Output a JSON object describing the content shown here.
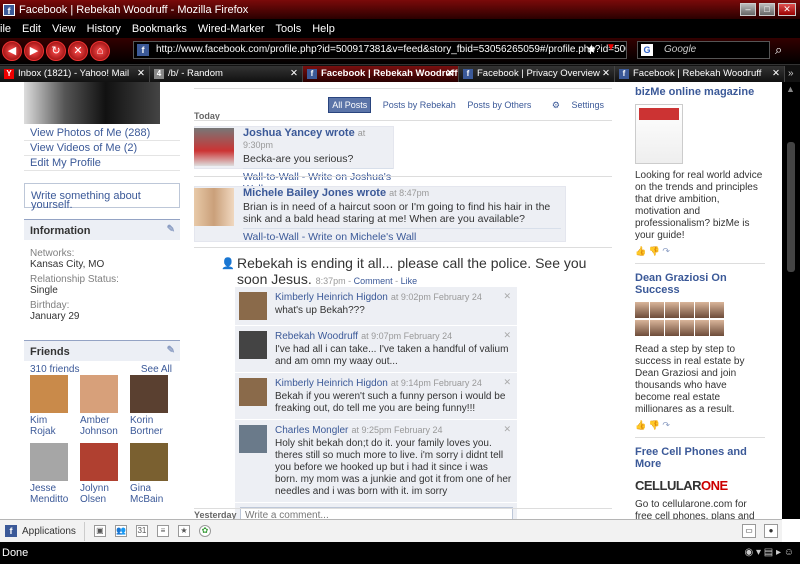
{
  "window": {
    "title": "Facebook | Rebekah Woodruff - Mozilla Firefox",
    "favicon": "f"
  },
  "menu": [
    "ile",
    "Edit",
    "View",
    "History",
    "Bookmarks",
    "Wired-Marker",
    "Tools",
    "Help"
  ],
  "nav": {
    "url": "http://www.facebook.com/profile.php?id=500917381&v=feed&story_fbid=53056265059#/profile.php?id=500917381",
    "search_placeholder": "Google",
    "search_engine": "G"
  },
  "tabs": [
    {
      "label": "Inbox (1821) - Yahoo! Mail",
      "icon": "y"
    },
    {
      "label": "/b/ - Random",
      "icon": "b"
    },
    {
      "label": "Facebook | Rebekah Woodruff",
      "icon": "f"
    },
    {
      "label": "Facebook | Privacy Overview",
      "icon": "f"
    },
    {
      "label": "Facebook | Rebekah Woodruff",
      "icon": "f"
    }
  ],
  "left": {
    "links": [
      "View Photos of Me (288)",
      "View Videos of Me (2)",
      "Edit My Profile"
    ],
    "write": "Write something about yourself.",
    "info_title": "Information",
    "info": [
      {
        "k": "Networks:",
        "v": "Kansas City, MO"
      },
      {
        "k": "Relationship Status:",
        "v": "Single"
      },
      {
        "k": "Birthday:",
        "v": "January 29"
      }
    ],
    "friends_title": "Friends",
    "friends_count": "310 friends",
    "see_all": "See All",
    "friends": [
      {
        "first": "Kim",
        "last": "Rojak",
        "color": "#c98a4a"
      },
      {
        "first": "Amber",
        "last": "Johnson",
        "color": "#d7a07a"
      },
      {
        "first": "Korin",
        "last": "Bortner",
        "color": "#5a4030"
      },
      {
        "first": "Jesse",
        "last": "Menditto",
        "color": "#a6a6a6"
      },
      {
        "first": "Jolynn",
        "last": "Olsen",
        "color": "#b04030"
      },
      {
        "first": "Gina",
        "last": "McBain",
        "color": "#7a6030"
      }
    ]
  },
  "feed": {
    "filters": {
      "all": "All Posts",
      "by_owner": "Posts by Rebekah",
      "by_others": "Posts by Others",
      "settings": "Settings"
    },
    "today": "Today",
    "yesterday": "Yesterday",
    "posts": [
      {
        "name": "Joshua Yancey",
        "verb": "wrote",
        "time": "at 9:30pm",
        "text": "Becka-are you serious?",
        "link": "Wall-to-Wall - Write on Joshua's Wall"
      },
      {
        "name": "Michele Bailey Jones",
        "verb": "wrote",
        "time": "at 8:47pm",
        "text": "Brian is in need of a haircut soon or I'm going to find his hair in the sink and a bald head staring at me! When are you available?",
        "link": "Wall-to-Wall - Write on Michele's Wall"
      }
    ],
    "status": {
      "text": "Rebekah is ending it all... please call the police. See you soon Jesus.",
      "time": "8:37pm",
      "comment": "Comment",
      "like": "Like"
    },
    "comments": [
      {
        "name": "Kimberly Heinrich Higdon",
        "time": "at 9:02pm February 24",
        "text": "what's up Bekah???",
        "color": "#8a6a4a"
      },
      {
        "name": "Rebekah Woodruff",
        "time": "at 9:07pm February 24",
        "text": "I've had all i can take... I've taken a handful of valium and am omn my waay out...",
        "color": "#444"
      },
      {
        "name": "Kimberly Heinrich Higdon",
        "time": "at 9:14pm February 24",
        "text": "Bekah if you weren't such a funny person i would be freaking out, do tell me you are being funny!!!",
        "color": "#8a6a4a"
      },
      {
        "name": "Charles Mongler",
        "time": "at 9:25pm February 24",
        "text": "Holy shit bekah don;t do it. your family loves you. theres still so much more to live. i'm sorry i didnt tell you before we hooked up but i had it since i was born. my mom was a junkie and got it from one of her needles and i was born with it. im sorry",
        "color": "#6a7a8a"
      }
    ],
    "add_comment": "Write a comment..."
  },
  "ads": [
    {
      "title": "bizMe online magazine",
      "text": "Looking for real world advice on the trends and principles that drive ambition, motivation and professionalism? bizMe is your guide!"
    },
    {
      "title": "Dean Graziosi On Success",
      "text": "Read a step by step to success in real estate by Dean Graziosi and join thousands who have become real estate millionares as a result."
    },
    {
      "title": "Free Cell Phones and More",
      "logo": "CELLULARONE",
      "text": "Go to cellularone.com for free cell phones, plans and much more shopping. Enter"
    }
  ],
  "appbar": {
    "applications": "Applications"
  },
  "statusbar": {
    "text": "Done"
  }
}
